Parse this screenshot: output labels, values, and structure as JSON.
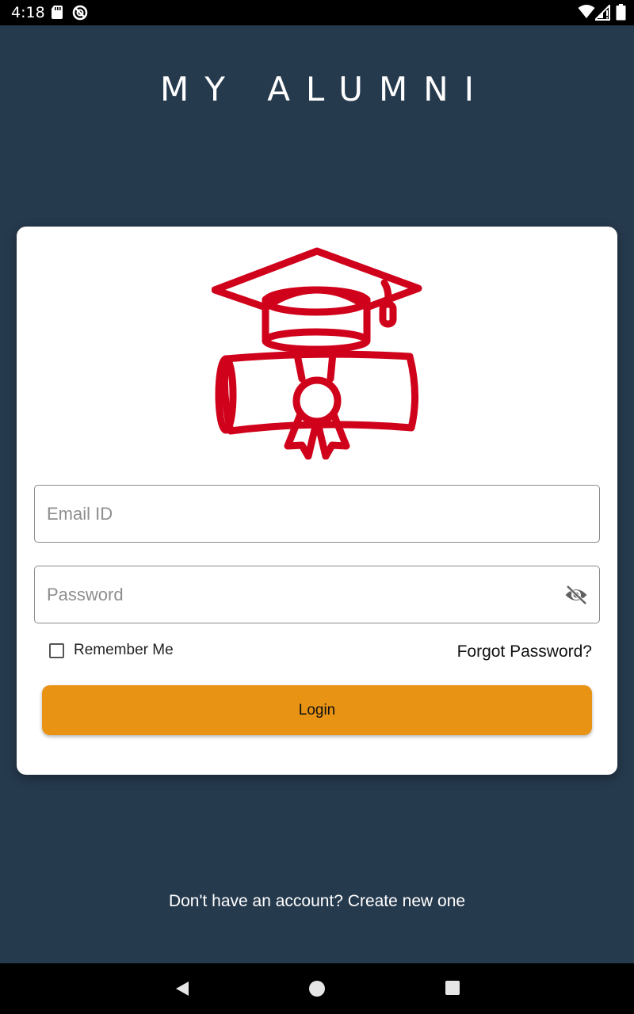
{
  "status_bar": {
    "time": "4:18",
    "icons": [
      "sd-card-icon",
      "data-saver-icon",
      "wifi-icon",
      "signal-icon",
      "battery-icon"
    ]
  },
  "app": {
    "title": "MY ALUMNI"
  },
  "logo": {
    "icon": "graduation-diploma-icon",
    "color": "#d0021b"
  },
  "form": {
    "email_placeholder": "Email ID",
    "email_value": "",
    "password_placeholder": "Password",
    "password_value": "",
    "password_toggle_icon": "eye-off-icon",
    "remember_label": "Remember Me",
    "remember_checked": false,
    "forgot_label": "Forgot Password?",
    "login_label": "Login"
  },
  "footer": {
    "signup_text": "Don't have an account? Create new one"
  },
  "nav_bar": {
    "icons": [
      "back-icon",
      "home-icon",
      "recents-icon"
    ]
  },
  "colors": {
    "background": "#263a4e",
    "accent": "#e89314",
    "logo": "#d0021b",
    "card": "#ffffff"
  }
}
